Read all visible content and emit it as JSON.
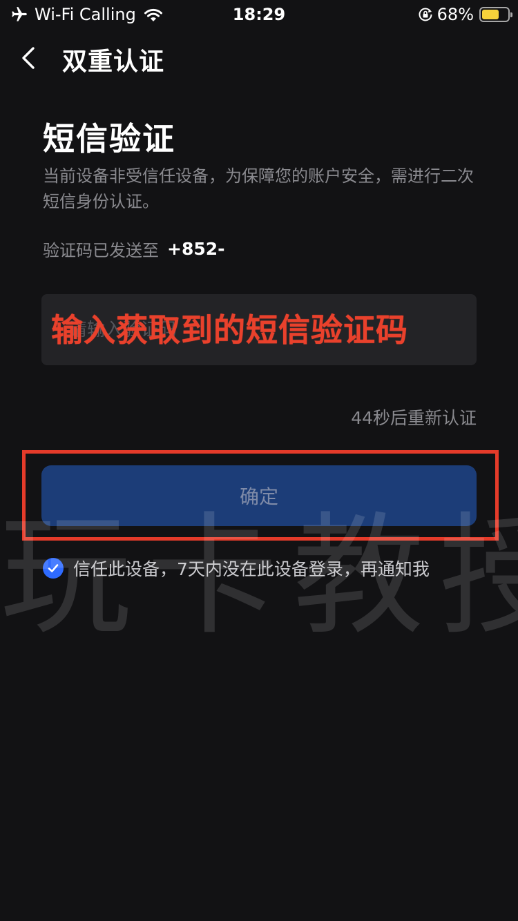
{
  "status_bar": {
    "carrier": "Wi-Fi Calling",
    "time": "18:29",
    "battery_percent": "68%",
    "battery_level": 0.68,
    "icons": [
      "airplane-icon",
      "wifi-icon",
      "orientation-lock-icon",
      "battery-icon"
    ],
    "battery_color": "#f6d23b"
  },
  "nav": {
    "back_icon": "chevron-left-icon",
    "title": "双重认证"
  },
  "main": {
    "title": "短信验证",
    "description": "当前设备非受信任设备，为保障您的账户安全，需进行二次短信身份认证。",
    "sent_label": "验证码已发送至",
    "phone_prefix": "+852-",
    "code_input": {
      "placeholder": "请输入验证码",
      "value": ""
    },
    "annotation_caption": "输入获取到的短信验证码",
    "resend_text": "44秒后重新认证",
    "confirm_label": "确定",
    "trust_device": {
      "checked": true,
      "label": "信任此设备，7天内没在此设备登录，再通知我"
    }
  },
  "watermark": "玩卡教授",
  "colors": {
    "background": "#121214",
    "button_disabled": "#1c3d78",
    "checkbox": "#2f6bff",
    "annotation_red": "#e53b2a"
  }
}
